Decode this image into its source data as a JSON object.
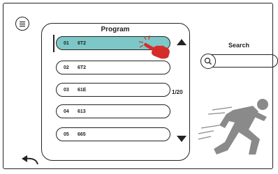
{
  "panel": {
    "title": "Program"
  },
  "programs": [
    {
      "num": "01",
      "name": "6T2",
      "selected": true
    },
    {
      "num": "02",
      "name": "6T2",
      "selected": false
    },
    {
      "num": "03",
      "name": "61E",
      "selected": false
    },
    {
      "num": "04",
      "name": "613",
      "selected": false
    },
    {
      "num": "05",
      "name": "665",
      "selected": false
    }
  ],
  "pagination": {
    "indicator": "1/20"
  },
  "search": {
    "label": "Search",
    "value": ""
  },
  "icons": {
    "menu": "menu-icon",
    "scroll_up": "triangle-up-icon",
    "scroll_down": "triangle-down-icon",
    "search": "search-icon",
    "back": "back-arrow-icon",
    "runner": "running-person-icon",
    "tap": "tap-hand-icon"
  },
  "colors": {
    "selected_row": "#7ec7c8",
    "hand": "#d62b2b",
    "runner": "#8a8a8a"
  }
}
